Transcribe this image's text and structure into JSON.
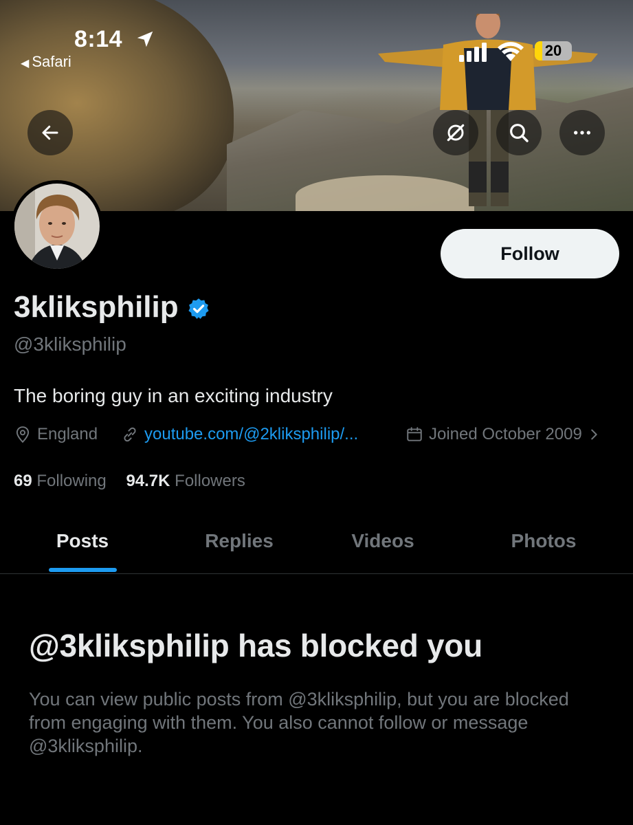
{
  "status_bar": {
    "time": "8:14",
    "back_app": "Safari",
    "battery_level": "20",
    "battery_fraction": 0.2,
    "icons": [
      "location-arrow-icon",
      "signal-icon",
      "wifi-icon",
      "battery-icon"
    ]
  },
  "banner_actions": {
    "back": "arrow-left-icon",
    "grok": "grok-icon",
    "search": "search-icon",
    "more": "more-icon"
  },
  "profile": {
    "follow_label": "Follow",
    "display_name": "3kliksphilip",
    "verified": true,
    "handle": "@3kliksphilip",
    "bio": "The boring guy in an exciting industry",
    "location": "England",
    "website": "youtube.com/@2kliksphilip/...",
    "joined": "Joined October 2009",
    "following_count": "69",
    "following_label": "Following",
    "followers_count": "94.7K",
    "followers_label": "Followers"
  },
  "tabs": [
    {
      "label": "Posts",
      "active": true
    },
    {
      "label": "Replies",
      "active": false
    },
    {
      "label": "Videos",
      "active": false
    },
    {
      "label": "Photos",
      "active": false
    }
  ],
  "blocked": {
    "title": "@3kliksphilip has blocked you",
    "body": "You can view public posts from @3kliksphilip, but you are blocked from engaging with them. You also cannot follow or message @3kliksphilip."
  },
  "colors": {
    "accent": "#1d9bf0",
    "background": "#000000",
    "primary_text": "#e7e9ea",
    "secondary_text": "#71767b",
    "battery_fill": "#ffd60a"
  }
}
